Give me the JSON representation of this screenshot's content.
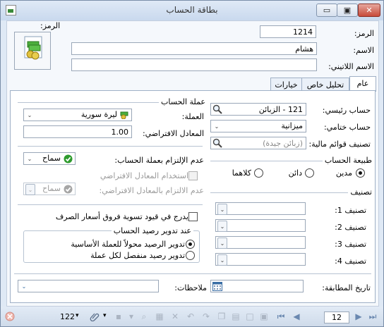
{
  "window": {
    "title": "بطاقة الحساب",
    "minimize_label": "▭",
    "maximize_label": "▣",
    "close_label": "✕"
  },
  "header": {
    "code_label": "الرمز:",
    "code_value": "1214",
    "name_label": "الاسم:",
    "name_value": "هشام",
    "latin_name_label": "الاسم اللاتيني:",
    "latin_name_value": "",
    "icon_label": "الرمز:"
  },
  "tabs": [
    "عام",
    "تحليل خاص",
    "خيارات"
  ],
  "general": {
    "parent_account_label": "حساب رئيسي:",
    "parent_account_value": "121 - الزبائن",
    "final_account_label": "حساب ختامي:",
    "final_account_value": "ميزانية",
    "fin_list_label": "تصنيف قوائم مالية:",
    "fin_list_placeholder": "(زبائن جيدة)",
    "nature_title": "طبيعة الحساب",
    "nature_options": [
      "مدين",
      "دائن",
      "كلاهما"
    ],
    "nature_selected": 0,
    "class_title": "تصنيف",
    "class_labels": [
      "تصنيف 1:",
      "تصنيف 2:",
      "تصنيف 3:",
      "تصنيف 4:"
    ],
    "match_date_label": "تاريخ المطابقة:",
    "currency_section": "عملة الحساب",
    "currency_label": "العملة:",
    "currency_value": "ليرة سورية",
    "default_rate_label": "المعادل الافتراضي:",
    "default_rate_value": "1.00",
    "non_commit_label": "عدم الإلتزام بعملة الحساب:",
    "non_commit_value": "سماح",
    "use_default_rate_label": "استخدام المعادل الافتراضي",
    "non_commit_rate_label": "عدم الالتزام بالمعادل الافتراضي:",
    "non_commit_rate_value": "سماح",
    "fx_diff_label": "يدرج في قيود تسوية فروق أسعار الصرف",
    "rounding_title": "عند تدوير رصيد الحساب",
    "rounding_options": [
      "تدوير الرصيد محولاً للعملة الأساسية",
      "تدوير رصيد منفصل لكل عملة"
    ],
    "rounding_selected": 0,
    "notes_label": "ملاحظات:"
  },
  "statusbar": {
    "page_value": "12",
    "zoom_value": "122"
  },
  "colors": {
    "accent": "#3a6ea5",
    "close": "#c74a3a",
    "ok_green": "#2e9b2e"
  }
}
